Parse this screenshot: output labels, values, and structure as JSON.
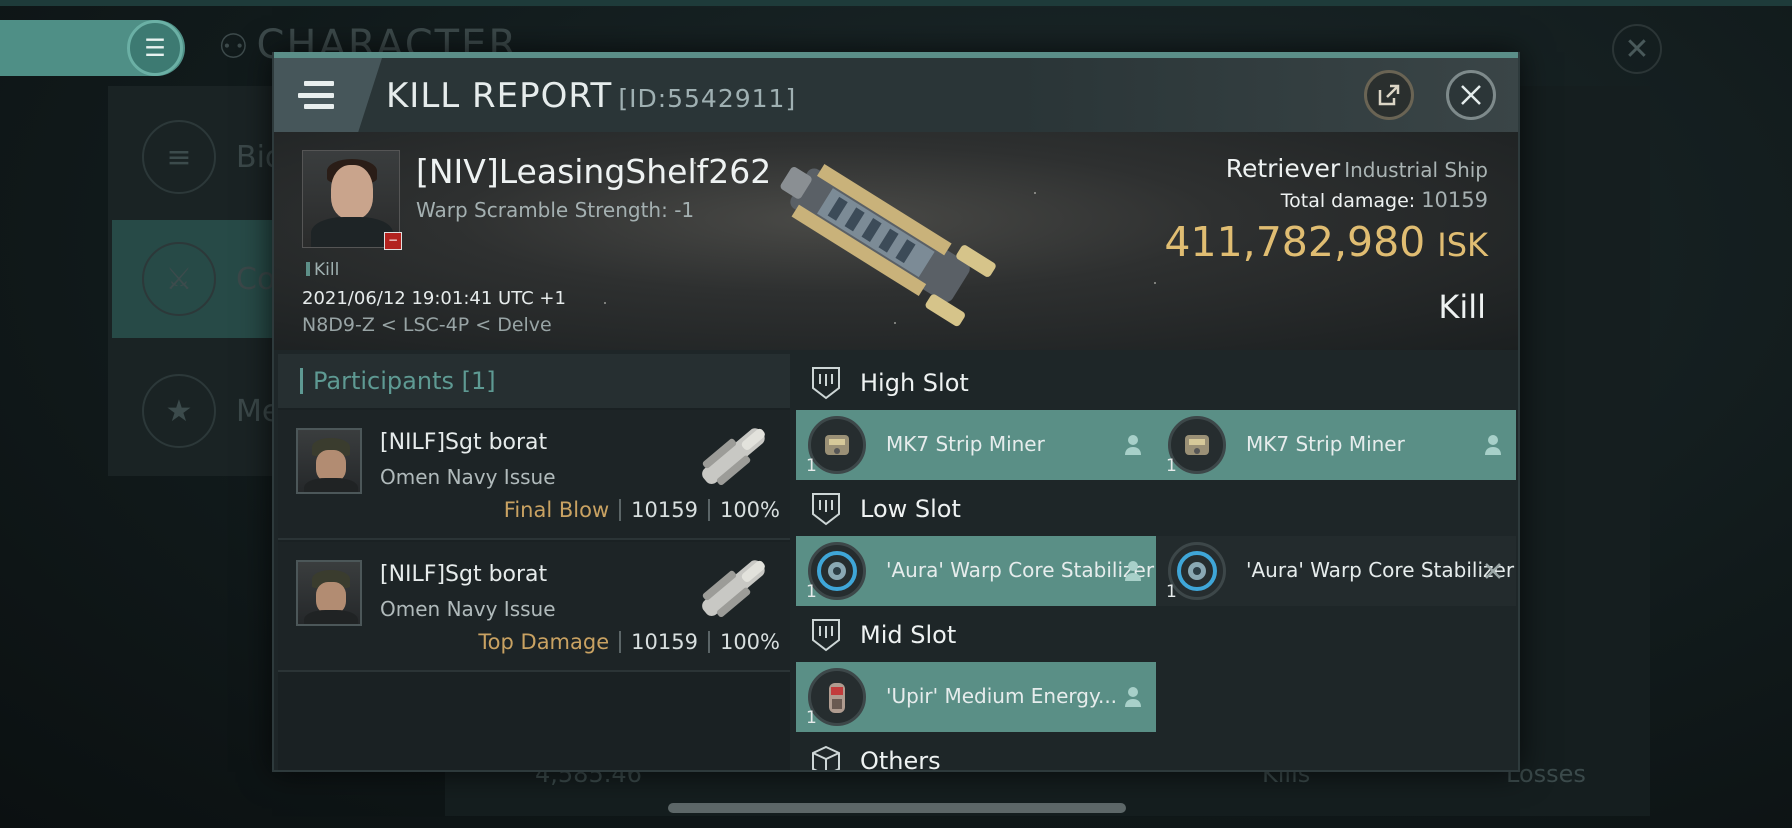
{
  "background": {
    "title": "CHARACTER",
    "side_items": [
      {
        "label": "Bio",
        "icon": "list-icon"
      },
      {
        "label": "Co",
        "icon": "crossed-swords-icon"
      },
      {
        "label": "Me",
        "icon": "star-icon"
      }
    ],
    "bottom_value": "4,585.46",
    "bottom_kills": "Kills",
    "bottom_losses": "Losses"
  },
  "header": {
    "title": "KILL REPORT",
    "report_id": "[ID:5542911]"
  },
  "victim": {
    "name": "[NIV]LeasingShelf262",
    "warp_scramble": "Warp Scramble Strength: -1",
    "tag": "Kill",
    "time": "2021/06/12 19:01:41 UTC +1",
    "location": "N8D9-Z < LSC-4P < Delve",
    "ship_name": "Retriever",
    "ship_class": "Industrial Ship",
    "total_damage_label": "Total damage:",
    "total_damage": "10159",
    "isk_value": "411,782,980",
    "isk_unit": "ISK",
    "result": "Kill"
  },
  "participants": {
    "label": "Participants",
    "count": "[1]",
    "rows": [
      {
        "name": "[NILF]Sgt borat",
        "ship": "Omen Navy Issue",
        "role": "Final Blow",
        "damage": "10159",
        "percent": "100%"
      },
      {
        "name": "[NILF]Sgt borat",
        "ship": "Omen Navy Issue",
        "role": "Top Damage",
        "damage": "10159",
        "percent": "100%"
      }
    ]
  },
  "slots": {
    "high": {
      "label": "High Slot",
      "modules": [
        {
          "name": "MK7 Strip Miner",
          "qty": "1"
        },
        {
          "name": "MK7 Strip Miner",
          "qty": "1"
        }
      ]
    },
    "low": {
      "label": "Low Slot",
      "modules": [
        {
          "name": "'Aura' Warp Core Stabilizer",
          "qty": "1"
        },
        {
          "name": "'Aura' Warp Core Stabilizer",
          "qty": "1"
        }
      ]
    },
    "mid": {
      "label": "Mid Slot",
      "modules": [
        {
          "name": "'Upir' Medium Energy...",
          "qty": "1"
        }
      ]
    },
    "others": {
      "label": "Others"
    }
  },
  "colors": {
    "accent": "#5a8f86",
    "isk": "#e0bd72",
    "role": "#c9a262"
  }
}
